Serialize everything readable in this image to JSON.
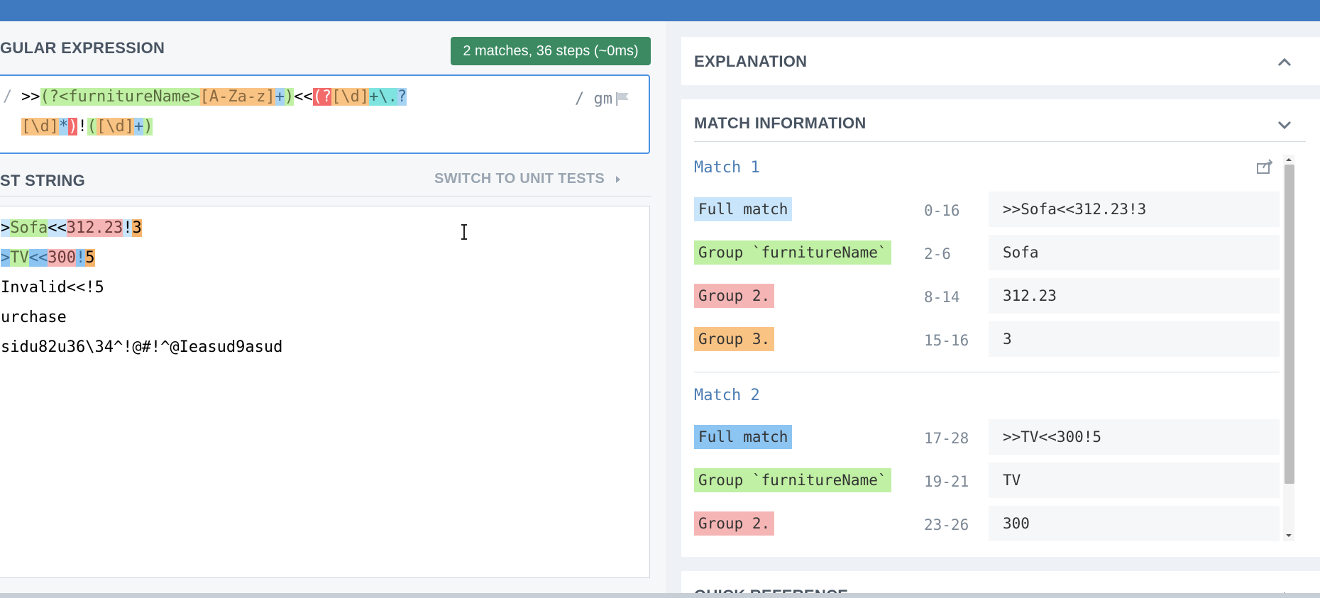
{
  "header": {},
  "regex_section": {
    "title": "GULAR EXPRESSION",
    "match_badge": "2 matches, 36 steps (~0ms)",
    "open_delim": "/",
    "flags": "/ gm",
    "line1": [
      {
        "text": ">>",
        "cls": ""
      },
      {
        "text": "(?<furnitureName>",
        "cls": "c-green"
      },
      {
        "text": "[A-Za-z]",
        "cls": "c-orange"
      },
      {
        "text": "+",
        "cls": "c-blue"
      },
      {
        "text": ")",
        "cls": "c-green"
      },
      {
        "text": "<<",
        "cls": ""
      },
      {
        "text": "(?",
        "cls": "c-red"
      },
      {
        "text": "[\\d]",
        "cls": "c-orange"
      },
      {
        "text": "+",
        "cls": "c-teal"
      },
      {
        "text": "\\.",
        "cls": "c-teal"
      },
      {
        "text": "?",
        "cls": "c-blue"
      }
    ],
    "line2": [
      {
        "text": "[\\d]",
        "cls": "c-orange"
      },
      {
        "text": "*",
        "cls": "c-blue"
      },
      {
        "text": ")",
        "cls": "c-red"
      },
      {
        "text": "!",
        "cls": ""
      },
      {
        "text": "(",
        "cls": "c-green"
      },
      {
        "text": "[\\d]",
        "cls": "c-orange"
      },
      {
        "text": "+",
        "cls": "c-blue"
      },
      {
        "text": ")",
        "cls": "c-green"
      }
    ]
  },
  "test_section": {
    "title": "ST STRING",
    "switch_label": "SWITCH TO UNIT TESTS",
    "lines": [
      [
        {
          "text": ">",
          "cls": "c-lightblue"
        },
        {
          "text": "Sofa",
          "cls": "c-green"
        },
        {
          "text": "<<",
          "cls": "c-lightblue"
        },
        {
          "text": "312.23",
          "cls": "c-pink"
        },
        {
          "text": "!",
          "cls": "c-lightblue"
        },
        {
          "text": "3",
          "cls": "c-or2"
        }
      ],
      [
        {
          "text": ">",
          "cls": "c-blue2"
        },
        {
          "text": "TV",
          "cls": "c-green"
        },
        {
          "text": "<<",
          "cls": "c-blue2"
        },
        {
          "text": "300",
          "cls": "c-pink"
        },
        {
          "text": "!",
          "cls": "c-blue2"
        },
        {
          "text": "5",
          "cls": "c-or2"
        }
      ],
      [
        {
          "text": "Invalid<<!5",
          "cls": ""
        }
      ],
      [
        {
          "text": "urchase",
          "cls": ""
        }
      ],
      [
        {
          "text": "sidu82u36\\34^!@#!^@Ieasud9asud",
          "cls": ""
        }
      ]
    ]
  },
  "explanation": {
    "title": "EXPLANATION"
  },
  "match_information": {
    "title": "MATCH INFORMATION",
    "matches": [
      {
        "title": "Match 1",
        "rows": [
          {
            "label": "Full match",
            "range": "0-16",
            "value": ">>Sofa<<312.23!3",
            "color": "#c9e5fb"
          },
          {
            "label": "Group `furnitureName`",
            "range": "2-6",
            "value": "Sofa",
            "color": "#bff0a3"
          },
          {
            "label": "Group 2.",
            "range": "8-14",
            "value": "312.23",
            "color": "#f6b5b5"
          },
          {
            "label": "Group 3.",
            "range": "15-16",
            "value": "3",
            "color": "#f9c384"
          }
        ]
      },
      {
        "title": "Match 2",
        "rows": [
          {
            "label": "Full match",
            "range": "17-28",
            "value": ">>TV<<300!5",
            "color": "#8cc4f2"
          },
          {
            "label": "Group `furnitureName`",
            "range": "19-21",
            "value": "TV",
            "color": "#bff0a3"
          },
          {
            "label": "Group 2.",
            "range": "23-26",
            "value": "300",
            "color": "#f6b5b5"
          }
        ]
      }
    ]
  },
  "quick_reference": {
    "title": "QUICK REFERENCE"
  }
}
